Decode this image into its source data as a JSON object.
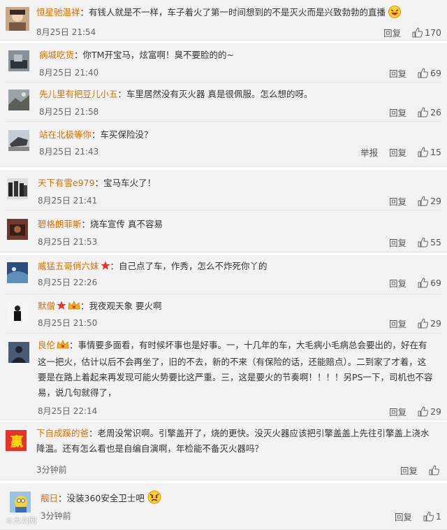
{
  "labels": {
    "reply": "回复",
    "report": "举报"
  },
  "colors": {
    "username": "#e06e00",
    "background": "#f3f3f3"
  },
  "comments": [
    {
      "user": "恒星驰温祥",
      "text": "有钱人就是不一样，车子着火了第一时间想到的不是灭火而是兴致勃勃的直播",
      "time": "8月25日 21:54",
      "likes": "170",
      "icon": "laughing-emoji-icon"
    },
    {
      "user": "病城吃货",
      "text": "你TM开宝马，炫富啊！臭不要脸的的~",
      "time": "8月25日 21:40",
      "likes": "69"
    },
    {
      "user": "先儿里有把豆儿小五",
      "text": "车里居然没有灭火器 真是很佩服。怎么想的呀。",
      "time": "8月25日 21:58",
      "likes": "26"
    },
    {
      "user": "站在北极等你",
      "text": "车买保险没？",
      "time": "8月25日 21:43",
      "likes": "15",
      "report": true
    },
    {
      "user": "天下有雪e979",
      "text": "宝马车火了！",
      "time": "8月25日 21:41",
      "likes": "29"
    },
    {
      "user": "碧格朗菲斯",
      "text": "烧车宣传 真不容易",
      "time": "8月25日 21:53",
      "likes": "55"
    },
    {
      "user": "威猛五哥俏六妹",
      "text": "自己点了车，作秀，怎么不炸死你丫的",
      "time": "8月25日 22:26",
      "likes": "69",
      "badges": [
        "star-badge-icon"
      ]
    },
    {
      "user": "默僧",
      "text": "我夜观天象 要火啊",
      "time": "8月25日 21:50",
      "likes": "29",
      "badges": [
        "star-badge-icon",
        "crown-badge-icon"
      ]
    },
    {
      "user": "良伦",
      "text": "事情要多面看，有时候坏事也是好事。一，十几年的车，大毛病小毛病总会要出的，好在有这一把火，估计以后不会再坐了，旧的不去，新的不来（有保险的话，还能赔点）。二到家了才着，这要是在路上着起来再发现可能火势要比这严重。三，这是要火的节奏啊！！！！另PS一下，司机也不容易，说几句就得了，",
      "time": "8月25日 22:14",
      "likes": "29",
      "badges": [
        "crown-badge-icon"
      ]
    },
    {
      "user": "下自成蹊的爸",
      "text": "老周没常识啊。引擎盖开了，烧的更快。没灭火器应该把引擎盖盖上先往引擎盖上浇水降温。还有怎么看也是自编自演啊，年检能不备灭火器吗？",
      "time": "3分钟前",
      "likes": ""
    },
    {
      "user": "靓日",
      "text": "没装360安全卫士吧",
      "time": "3分钟前",
      "likes": "1",
      "icon": "angry-emoji-icon"
    }
  ],
  "watermark": "©大众网"
}
